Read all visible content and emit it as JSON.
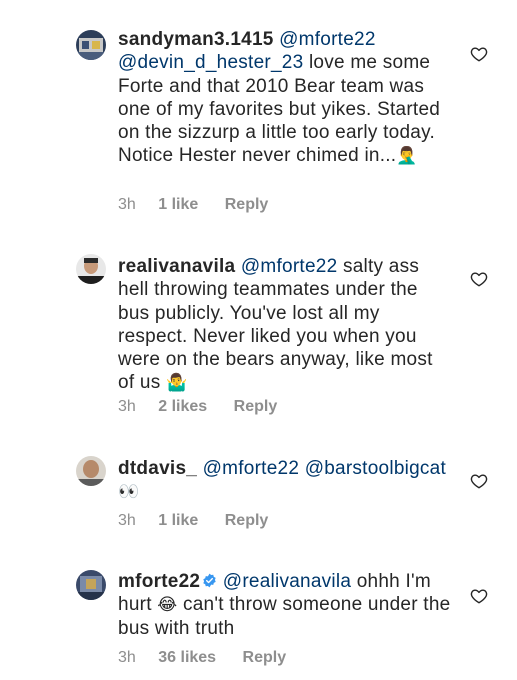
{
  "comments": [
    {
      "username": "sandyman3.1415",
      "mentions": [
        "@mforte22",
        "@devin_d_hester_23"
      ],
      "text": "love me some Forte and that 2010 Bear team was one of my favorites but yikes. Started on the sizzurp a little too early today. Notice Hester never chimed in...",
      "emoji": "🤦‍♂️",
      "time": "3h",
      "likes": "1 like",
      "reply": "Reply",
      "verified": false
    },
    {
      "username": "realivanavila",
      "mentions": [
        "@mforte22"
      ],
      "text": "salty ass hell throwing teammates under the bus publicly. You've lost all my respect. Never liked you when you were on the bears anyway, like most of us",
      "emoji": "🤷‍♂️",
      "time": "3h",
      "likes": "2 likes",
      "reply": "Reply",
      "verified": false
    },
    {
      "username": "dtdavis_",
      "mentions": [
        "@mforte22",
        "@barstoolbigcat"
      ],
      "text": "",
      "emoji": "👀",
      "time": "3h",
      "likes": "1 like",
      "reply": "Reply",
      "verified": false
    },
    {
      "username": "mforte22",
      "mentions": [
        "@realivanavila"
      ],
      "text": "ohhh I'm hurt",
      "emoji": "😂",
      "text_after": "can't throw someone under the bus with truth",
      "time": "3h",
      "likes": "36 likes",
      "reply": "Reply",
      "verified": true
    }
  ],
  "colors": {
    "text": "#262626",
    "mention": "#00376b",
    "meta": "#8e8e8e",
    "verified": "#3897f0"
  },
  "icons": {
    "like": "heart-outline-icon",
    "verified": "verified-badge-icon"
  }
}
